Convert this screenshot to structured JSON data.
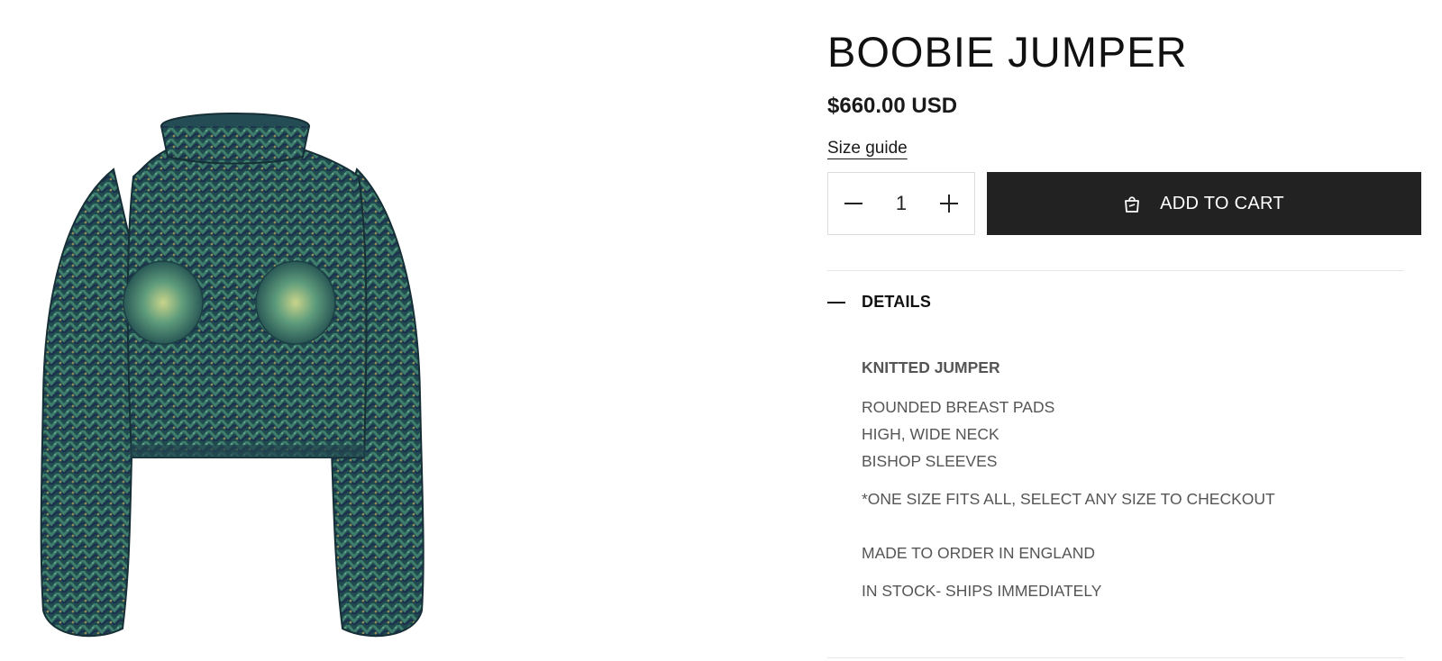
{
  "product": {
    "title": "BOOBIE JUMPER",
    "price": "$660.00 USD",
    "size_guide_label": "Size guide",
    "image_icon": "knitted-jumper-image"
  },
  "purchase": {
    "quantity": "1",
    "decrease_icon": "minus-icon",
    "increase_icon": "plus-icon",
    "add_to_cart_label": "ADD TO CART",
    "cart_icon": "shopping-bag-icon",
    "button_color": "#222222"
  },
  "details": {
    "toggle_label": "DETAILS",
    "toggle_icon": "minus-dash-icon",
    "heading": "KNITTED JUMPER",
    "features": [
      "ROUNDED BREAST PADS",
      "HIGH, WIDE NECK",
      "BISHOP SLEEVES"
    ],
    "size_note": "*ONE SIZE FITS ALL, SELECT ANY SIZE TO CHECKOUT",
    "made_note": "MADE TO ORDER IN ENGLAND",
    "stock_note": "IN STOCK- SHIPS IMMEDIATELY"
  },
  "colors": {
    "sweater_base": "#1f4a4e",
    "sweater_light": "#4f8d78",
    "sweater_dark": "#1d2e50",
    "sweater_accent": "#8a8f58"
  }
}
